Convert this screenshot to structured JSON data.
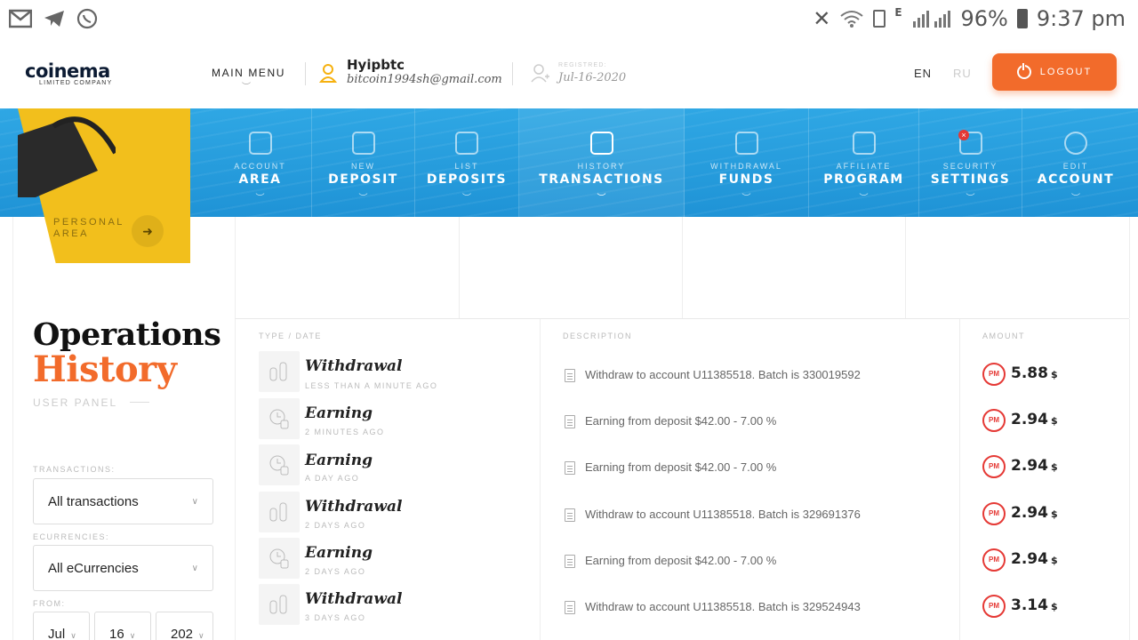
{
  "status_bar": {
    "battery": "96%",
    "time": "9:37 pm",
    "network_type": "E",
    "left_icons": [
      "gmail-icon",
      "telegram-icon",
      "whatsapp-icon"
    ],
    "right_icons": [
      "mute-icon",
      "wifi-icon",
      "sim-icon",
      "signal-icon",
      "battery-icon"
    ]
  },
  "header": {
    "logo_text": "coinema",
    "logo_subtitle": "LIMITED COMPANY",
    "main_menu": "MAIN MENU",
    "user_name": "Hyipbtc",
    "user_email": "bitcoin1994sh@gmail.com",
    "registered_label": "REGISTRED:",
    "registered_date": "Jul-16-2020",
    "lang_en": "EN",
    "lang_ru": "RU",
    "logout": "LOGOUT"
  },
  "colors": {
    "accent_orange": "#f26b2b",
    "nav_blue": "#2fa7e4",
    "yellow": "#f2bf1c",
    "pm_red": "#e53935"
  },
  "nav": [
    {
      "small": "ACCOUNT",
      "big": "AREA",
      "icon": "id-card-icon"
    },
    {
      "small": "NEW",
      "big": "DEPOSIT",
      "icon": "wallet-icon"
    },
    {
      "small": "LIST",
      "big": "DEPOSITS",
      "icon": "safe-icon"
    },
    {
      "small": "HISTORY",
      "big": "TRANSACTIONS",
      "icon": "calendar-icon"
    },
    {
      "small": "WITHDRAWAL",
      "big": "FUNDS",
      "icon": "coins-icon"
    },
    {
      "small": "AFFILIATE",
      "big": "PROGRAM",
      "icon": "users-icon"
    },
    {
      "small": "SECURITY",
      "big": "SETTINGS",
      "icon": "shield-icon"
    },
    {
      "small": "EDIT",
      "big": "ACCOUNT",
      "icon": "gear-icon"
    }
  ],
  "personal_area": {
    "line1": "PERSONAL",
    "line2": "AREA"
  },
  "page": {
    "title_1": "Operations",
    "title_2": "History",
    "subtitle": "USER PANEL"
  },
  "filters": {
    "transactions_label": "TRANSACTIONS:",
    "transactions_value": "All transactions",
    "ecurrencies_label": "ECURRENCIES:",
    "ecurrencies_value": "All eCurrencies",
    "from_label": "FROM:",
    "from_month": "Jul",
    "from_day": "16",
    "from_year": "202"
  },
  "table": {
    "headers": {
      "type": "TYPE / DATE",
      "description": "DESCRIPTION",
      "amount": "AMOUNT"
    },
    "rows": [
      {
        "type": "Withdrawal",
        "time": "LESS THAN A MINUTE AGO",
        "desc": "Withdraw to account U11385518. Batch is 330019592",
        "amount": "5.88",
        "currency": "$",
        "icon": "coins-stack-icon"
      },
      {
        "type": "Earning",
        "time": "2 MINUTES AGO",
        "desc": "Earning from deposit $42.00 - 7.00 %",
        "amount": "2.94",
        "currency": "$",
        "icon": "clock-coins-icon"
      },
      {
        "type": "Earning",
        "time": "A DAY AGO",
        "desc": "Earning from deposit $42.00 - 7.00 %",
        "amount": "2.94",
        "currency": "$",
        "icon": "clock-coins-icon"
      },
      {
        "type": "Withdrawal",
        "time": "2 DAYS AGO",
        "desc": "Withdraw to account U11385518. Batch is 329691376",
        "amount": "2.94",
        "currency": "$",
        "icon": "coins-stack-icon"
      },
      {
        "type": "Earning",
        "time": "2 DAYS AGO",
        "desc": "Earning from deposit $42.00 - 7.00 %",
        "amount": "2.94",
        "currency": "$",
        "icon": "clock-coins-icon"
      },
      {
        "type": "Withdrawal",
        "time": "3 DAYS AGO",
        "desc": "Withdraw to account U11385518. Batch is 329524943",
        "amount": "3.14",
        "currency": "$",
        "icon": "coins-stack-icon"
      }
    ],
    "pm_label": "PM"
  }
}
